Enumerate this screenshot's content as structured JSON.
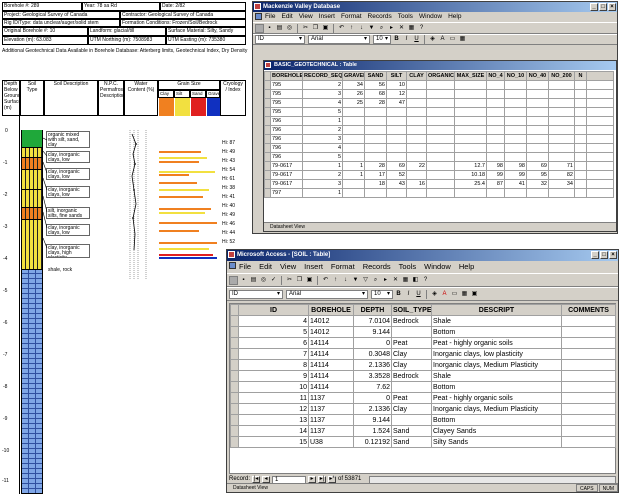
{
  "log": {
    "header_rows": [
      [
        "Borehole #: 289",
        "Year: 78 sa Rd",
        "Date: 2/82"
      ],
      [
        "Project: Geological Survey of Canada",
        "Contractor: Geological Survey of Canada",
        ""
      ],
      [
        "Rig ID/Type: data unclear/auger/solid stem",
        "Formation Conditions: Frozen/Soil/Bedrock",
        ""
      ],
      [
        "Original Borehole #: 10",
        "Landform: glacial/till",
        "Surface Material: Silty, Sandy"
      ],
      [
        "Elevation (m): 63.083",
        "UTM Northing (m): 7508983",
        "UTM Easting (m): 735380"
      ]
    ],
    "subtitle": "Additional Geotechnical Data Available in Borehole Database:  Atterberg limits, Geotechnical Index, Dry Density",
    "col_heads": [
      "Depth Below Ground Surface (m)",
      "Soil Type",
      "Soil Description",
      "N.P.C. Permafrost Description",
      "Water Content (%)",
      "Grain Size",
      "Cryology / Index"
    ],
    "grain_heads": [
      "Clay",
      "Silt",
      "Sand",
      "Gravel"
    ],
    "depth_ticks": [
      "0",
      "-1",
      "-2",
      "-3",
      "-4",
      "-5",
      "-6",
      "-7",
      "-8",
      "-9",
      "-10",
      "-11"
    ],
    "descriptions": [
      "organic mixed with silt, sand, clay",
      "clay, inorganic clays, low plasticity",
      "clay, inorganic clays, low plasticity",
      "clay, inorganic clays, low plasticity",
      "silt, inorganic silts, fine sands",
      "clay, inorganic clays, low plasticity",
      "clay, inorganic clays, high plasticity",
      "shale, rock"
    ],
    "index_values": [
      "Hi: 87",
      "Hi: 49",
      "Hi: 43",
      "Hi: 54",
      "Hi: 61",
      "Hi: 38",
      "Hi: 41",
      "Hi: 40",
      "Hi: 49",
      "Hi: 46",
      "Hi: 44",
      "Hi: 52"
    ],
    "colors": {
      "organic": "#1fa83a",
      "clay": "#f2e040",
      "silt": "#f08020",
      "shale": "#7fa6e6",
      "grain_clay": "#f08020",
      "grain_silt": "#f2e040",
      "grain_sand": "#e02020",
      "grain_gravel": "#1030c0"
    }
  },
  "mvdb": {
    "title": "Mackenzie Valley Database",
    "menu": [
      "File",
      "Edit",
      "View",
      "Insert",
      "Format",
      "Records",
      "Tools",
      "Window",
      "Help"
    ],
    "field_box": "ID",
    "font_box": "Arial",
    "size_box": "10",
    "table_title": "BASIC_GEOTECHNICAL : Table",
    "columns": [
      "BOREHOLE",
      "RECORD_SEQ",
      "GRAVEL",
      "SAND",
      "SILT",
      "CLAY",
      "ORGANIC",
      "MAX_SIZE",
      "NO_4",
      "NO_10",
      "NO_40",
      "NO_200",
      "N"
    ],
    "rows": [
      [
        "795",
        "2",
        "34",
        "56",
        "10",
        "",
        "",
        "",
        "",
        "",
        "",
        "",
        ""
      ],
      [
        "795",
        "3",
        "26",
        "68",
        "12",
        "",
        "",
        "",
        "",
        "",
        "",
        "",
        ""
      ],
      [
        "795",
        "4",
        "25",
        "28",
        "47",
        "",
        "",
        "",
        "",
        "",
        "",
        "",
        ""
      ],
      [
        "795",
        "5",
        "",
        "",
        "",
        "",
        "",
        "",
        "",
        "",
        "",
        "",
        ""
      ],
      [
        "796",
        "1",
        "",
        "",
        "",
        "",
        "",
        "",
        "",
        "",
        "",
        "",
        ""
      ],
      [
        "796",
        "2",
        "",
        "",
        "",
        "",
        "",
        "",
        "",
        "",
        "",
        "",
        ""
      ],
      [
        "796",
        "3",
        "",
        "",
        "",
        "",
        "",
        "",
        "",
        "",
        "",
        "",
        ""
      ],
      [
        "796",
        "4",
        "",
        "",
        "",
        "",
        "",
        "",
        "",
        "",
        "",
        "",
        ""
      ],
      [
        "796",
        "5",
        "",
        "",
        "",
        "",
        "",
        "",
        "",
        "",
        "",
        "",
        ""
      ],
      [
        "79-0617",
        "1",
        "1",
        "28",
        "69",
        "22",
        "",
        "12.7",
        "98",
        "98",
        "69",
        "71",
        ""
      ],
      [
        "79-0617",
        "2",
        "1",
        "17",
        "52",
        "",
        "",
        "10.18",
        "99",
        "99",
        "95",
        "82",
        ""
      ],
      [
        "79-0617",
        "3",
        "",
        "18",
        "43",
        "16",
        "",
        "25.4",
        "87",
        "41",
        "32",
        "34",
        ""
      ],
      [
        "797",
        "1",
        "",
        "",
        "",
        "",
        "",
        "",
        "",
        "",
        "",
        "",
        ""
      ]
    ],
    "status": "Datasheet View"
  },
  "access": {
    "title": "Microsoft Access - [SOIL : Table]",
    "menu": [
      "File",
      "Edit",
      "View",
      "Insert",
      "Format",
      "Records",
      "Tools",
      "Window",
      "Help"
    ],
    "field_box": "ID",
    "font_box": "Arial",
    "size_box": "10",
    "columns": [
      "ID",
      "BOREHOLE",
      "DEPTH",
      "SOIL_TYPE",
      "DESCRIPT",
      "COMMENTS"
    ],
    "rows": [
      [
        "4",
        "14012",
        "7.0104",
        "Bedrock",
        "Shale",
        ""
      ],
      [
        "5",
        "14012",
        "9.144",
        "",
        "Bottom",
        ""
      ],
      [
        "6",
        "14114",
        "0",
        "Peat",
        "Peat - highly organic soils",
        ""
      ],
      [
        "7",
        "14114",
        "0.3048",
        "Clay",
        "Inorganic clays, low plasticity",
        ""
      ],
      [
        "8",
        "14114",
        "2.1336",
        "Clay",
        "Inorganic clays, Medium Plasticity",
        ""
      ],
      [
        "9",
        "14114",
        "3.3528",
        "Bedrock",
        "Shale",
        ""
      ],
      [
        "10",
        "14114",
        "7.62",
        "",
        "Bottom",
        ""
      ],
      [
        "11",
        "1137",
        "0",
        "Peat",
        "Peat - highly organic soils",
        ""
      ],
      [
        "12",
        "1137",
        "2.1336",
        "Clay",
        "Inorganic clays, Medium Plasticity",
        ""
      ],
      [
        "13",
        "1137",
        "9.144",
        "",
        "Bottom",
        ""
      ],
      [
        "14",
        "1137",
        "1.524",
        "Sand",
        "Clayey Sands",
        ""
      ],
      [
        "15",
        "U38",
        "0.12192",
        "Sand",
        "Silty Sands",
        ""
      ]
    ],
    "record_label": "Record:",
    "record_current": "1",
    "record_of": "of 53871",
    "status": "Datasheet View",
    "status_right": [
      "CAPS",
      "NUM"
    ]
  }
}
